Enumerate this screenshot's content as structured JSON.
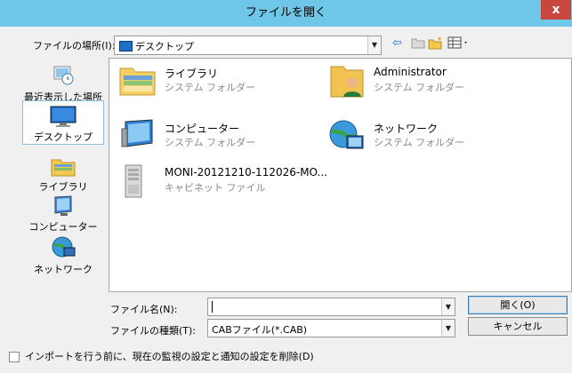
{
  "window": {
    "title": "ファイルを開く",
    "close_glyph": "x"
  },
  "lookin": {
    "label": "ファイルの場所(I):",
    "value": "デスクトップ"
  },
  "toolbar": {
    "back_glyph": "⇦"
  },
  "places": [
    {
      "label": "最近表示した場所",
      "icon": "recent-places-icon"
    },
    {
      "label": "デスクトップ",
      "icon": "desktop-icon",
      "selected": true
    },
    {
      "label": "ライブラリ",
      "icon": "libraries-icon"
    },
    {
      "label": "コンピューター",
      "icon": "computer-icon"
    },
    {
      "label": "ネットワーク",
      "icon": "network-icon"
    }
  ],
  "items": [
    {
      "name": "ライブラリ",
      "type": "システム フォルダー",
      "icon": "libraries-folder-icon"
    },
    {
      "name": "Administrator",
      "type": "システム フォルダー",
      "icon": "user-folder-icon"
    },
    {
      "name": "コンピューター",
      "type": "システム フォルダー",
      "icon": "computer-icon"
    },
    {
      "name": "ネットワーク",
      "type": "システム フォルダー",
      "icon": "network-icon"
    },
    {
      "name": "MONI-20121210-112026-MO...",
      "type": "キャビネット ファイル",
      "icon": "cabinet-file-icon"
    }
  ],
  "filename": {
    "label": "ファイル名(N):",
    "value": ""
  },
  "filetype": {
    "label": "ファイルの種類(T):",
    "value": "CABファイル(*.CAB)"
  },
  "buttons": {
    "open": "開く(O)",
    "cancel": "キャンセル"
  },
  "option": {
    "label": "インポートを行う前に、現在の監視の設定と通知の設定を削除(D)",
    "checked": false
  }
}
